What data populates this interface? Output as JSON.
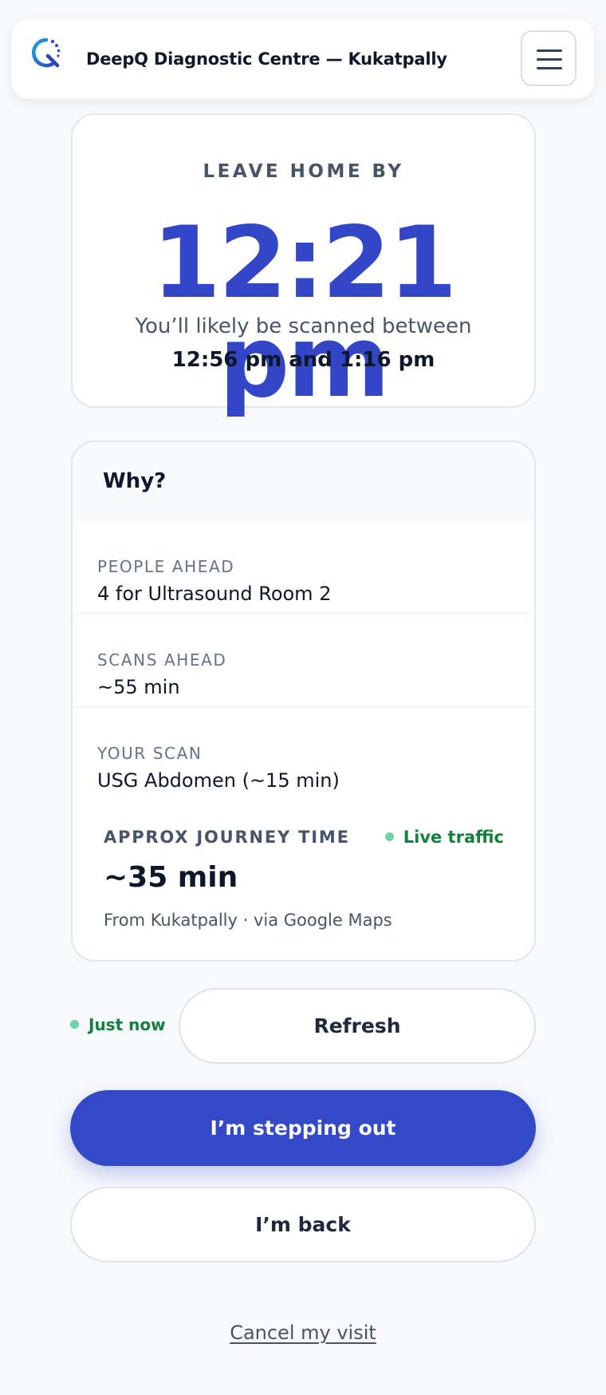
{
  "header": {
    "title": "DeepQ Diagnostic Centre — Kukatpally",
    "logo_icon": "deepq-logo-icon",
    "menu_icon": "hamburger-menu-icon",
    "brand_colors": [
      "#1aa7d9",
      "#3346c8"
    ]
  },
  "hero": {
    "eyebrow": "LEAVE HOME BY",
    "time": "12:21 pm",
    "subtitle": "You’ll likely be scanned between",
    "range": "12:56 pm and 1:16 pm"
  },
  "why": {
    "title": "Why?",
    "rows": [
      {
        "label": "PEOPLE AHEAD",
        "value": "4 for Ultrasound Room 2"
      },
      {
        "label": "SCANS AHEAD",
        "value": "~55 min"
      },
      {
        "label": "YOUR SCAN",
        "value": "USG Abdomen (~15 min)"
      }
    ],
    "journey": {
      "label": "APPROX JOURNEY TIME",
      "live": "Live traffic",
      "time": "~35 min",
      "source": "From Kukatpally · via Google Maps"
    }
  },
  "status": {
    "updated": "Just now"
  },
  "actions": {
    "refresh": "Refresh",
    "stepping_out": "I’m stepping out",
    "back": "I’m back",
    "cancel": "Cancel my visit"
  },
  "colors": {
    "accent": "#3346c8",
    "live_green": "#15803d",
    "dot_green": "#6ed3a6",
    "page_bg": "#f7f9fc"
  }
}
